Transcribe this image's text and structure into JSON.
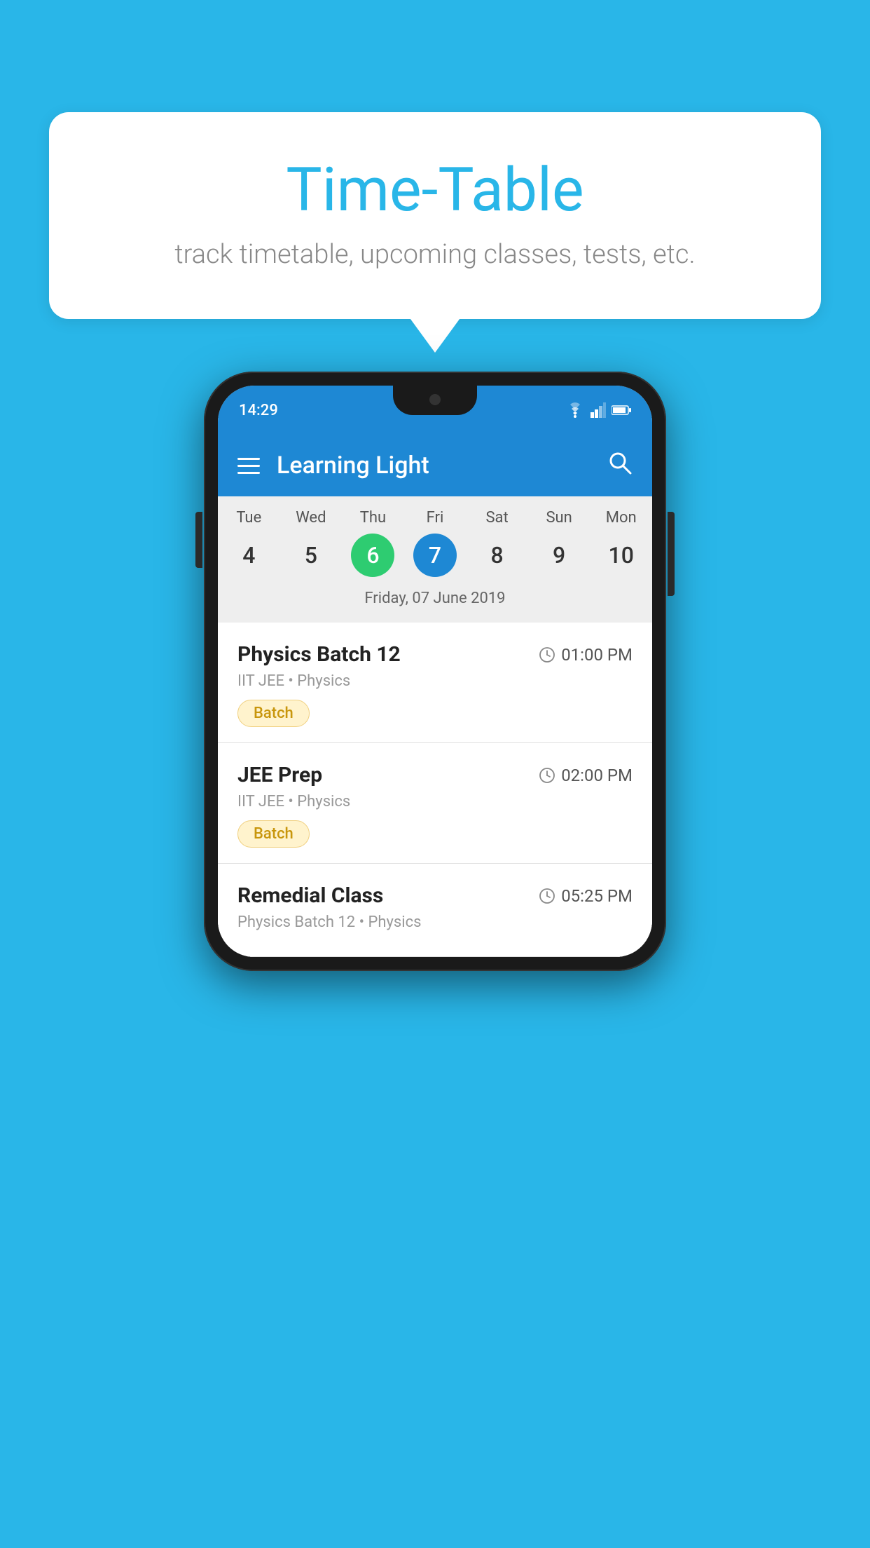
{
  "background_color": "#29B6E8",
  "speech_bubble": {
    "title": "Time-Table",
    "subtitle": "track timetable, upcoming classes, tests, etc."
  },
  "phone": {
    "status_bar": {
      "time": "14:29",
      "icons": [
        "wifi",
        "signal",
        "battery"
      ]
    },
    "app_header": {
      "title": "Learning Light",
      "menu_icon": "hamburger",
      "search_icon": "search"
    },
    "calendar": {
      "days": [
        "Tue",
        "Wed",
        "Thu",
        "Fri",
        "Sat",
        "Sun",
        "Mon"
      ],
      "dates": [
        "4",
        "5",
        "6",
        "7",
        "8",
        "9",
        "10"
      ],
      "today_index": 2,
      "selected_index": 3,
      "selected_date_label": "Friday, 07 June 2019"
    },
    "schedule": [
      {
        "title": "Physics Batch 12",
        "time": "01:00 PM",
        "subtitle": "IIT JEE • Physics",
        "badge": "Batch"
      },
      {
        "title": "JEE Prep",
        "time": "02:00 PM",
        "subtitle": "IIT JEE • Physics",
        "badge": "Batch"
      },
      {
        "title": "Remedial Class",
        "time": "05:25 PM",
        "subtitle": "Physics Batch 12 • Physics",
        "badge": ""
      }
    ]
  }
}
